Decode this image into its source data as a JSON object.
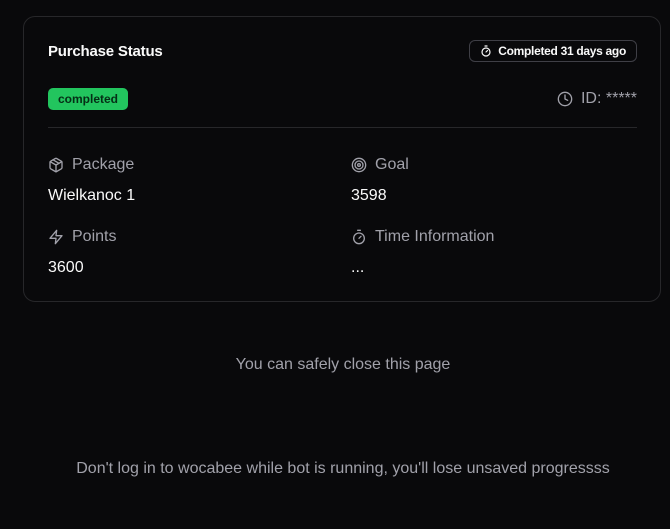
{
  "card": {
    "title": "Purchase Status",
    "time_badge": {
      "icon": "timer-icon",
      "label": "Completed 31 days ago"
    },
    "status": {
      "label": "completed",
      "color": "#22c55e"
    },
    "id": {
      "icon": "clock-icon",
      "label": "ID: *****"
    },
    "fields": {
      "package": {
        "icon": "package-icon",
        "label": "Package",
        "value": "Wielkanoc 1"
      },
      "goal": {
        "icon": "target-icon",
        "label": "Goal",
        "value": "3598"
      },
      "points": {
        "icon": "zap-icon",
        "label": "Points",
        "value": "3600"
      },
      "time": {
        "icon": "timer-icon",
        "label": "Time Information",
        "value": "..."
      }
    }
  },
  "messages": {
    "close": "You can safely close this page",
    "warning": "Don't log in to wocabee while bot is running, you'll lose unsaved progressss"
  }
}
